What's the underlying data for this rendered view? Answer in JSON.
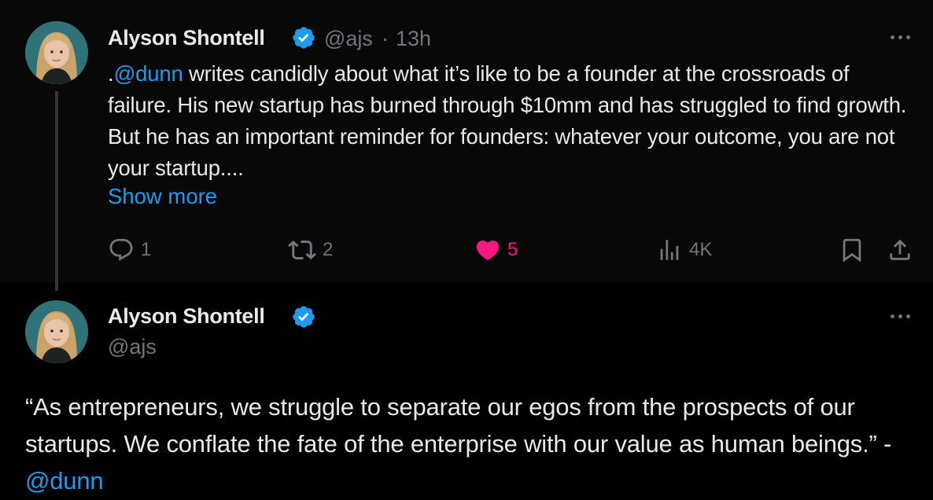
{
  "colors": {
    "accent": "#1d9bf0",
    "like": "#f91880",
    "muted": "#71767b",
    "text": "#e7e9ea"
  },
  "tweet1": {
    "author_name": "Alyson Shontell",
    "handle": "@ajs",
    "separator": "·",
    "time": "13h",
    "text_prefix": ".",
    "mention": "@dunn",
    "text_body": " writes candidly about what it’s like to be a founder at the crossroads of failure. His new startup has burned through $10mm and has struggled to find growth. But he has an important reminder for founders: whatever your outcome, you are not your startup....",
    "show_more": "Show more",
    "actions": {
      "replies": "1",
      "reposts": "2",
      "likes": "5",
      "views": "4K"
    }
  },
  "tweet2": {
    "author_name": "Alyson Shontell",
    "handle": "@ajs",
    "text_body": "“As entrepreneurs, we struggle to separate our egos from the prospects of our startups. We conflate the fate of the enterprise with our value as human beings.” - ",
    "mention": "@dunn"
  },
  "icons": {
    "verified": "verified-badge-icon",
    "more": "more-options-icon",
    "reply": "reply-icon",
    "repost": "repost-icon",
    "like": "heart-icon",
    "views": "views-icon",
    "bookmark": "bookmark-icon",
    "share": "share-icon"
  }
}
